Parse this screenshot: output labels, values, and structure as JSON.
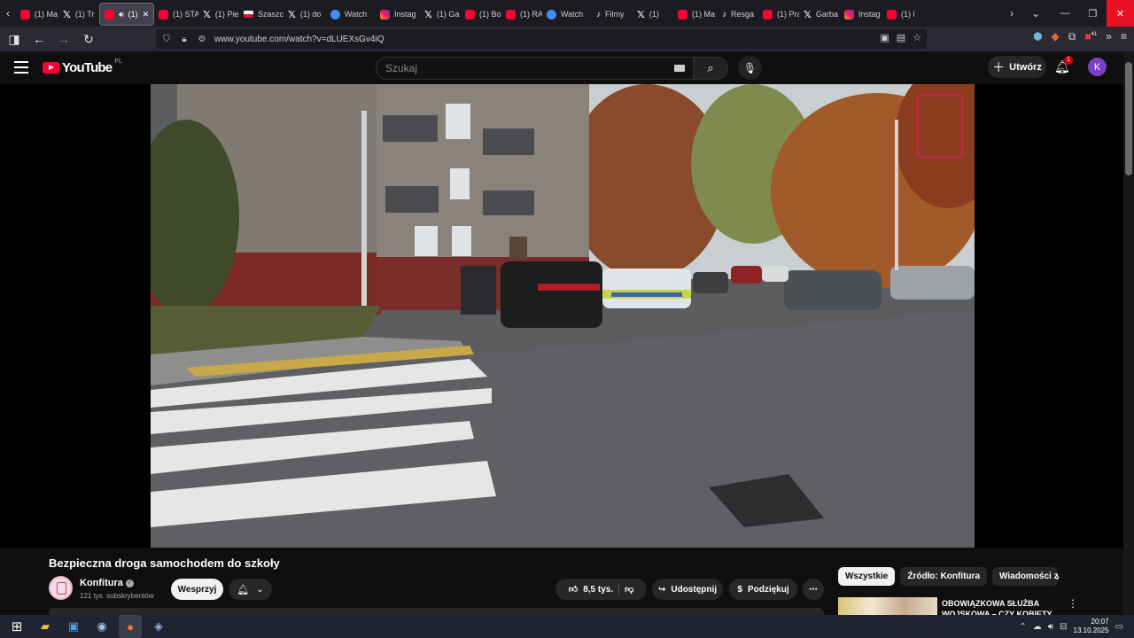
{
  "browser": {
    "tabs": [
      {
        "icon": "youtube-icon",
        "label": "(1) Ma"
      },
      {
        "icon": "x-icon",
        "label": "(1) Tr"
      },
      {
        "icon": "youtube-icon",
        "label": "(1)",
        "active": true,
        "audio": true
      },
      {
        "icon": "youtube-icon",
        "label": "(1) STA"
      },
      {
        "icon": "x-icon",
        "label": "(1) Pie"
      },
      {
        "icon": "flag-icon",
        "label": "Szaszc"
      },
      {
        "icon": "x-icon",
        "label": "(1) do"
      },
      {
        "icon": "watch-icon",
        "label": "Watch"
      },
      {
        "icon": "instagram-icon",
        "label": "Instag"
      },
      {
        "icon": "x-icon",
        "label": "(1) Ga"
      },
      {
        "icon": "youtube-icon",
        "label": "(1) Bo"
      },
      {
        "icon": "youtube-icon",
        "label": "(1) RA"
      },
      {
        "icon": "watch-icon",
        "label": "Watch"
      },
      {
        "icon": "tiktok-icon",
        "label": "Filmy"
      },
      {
        "icon": "x-icon",
        "label": "(1)"
      },
      {
        "icon": "youtube-icon",
        "label": "(1) Ma"
      },
      {
        "icon": "tiktok-icon",
        "label": "Resga"
      },
      {
        "icon": "youtube-icon",
        "label": "(1) Pra"
      },
      {
        "icon": "x-icon",
        "label": "Garba"
      },
      {
        "icon": "instagram-icon",
        "label": "Instag"
      },
      {
        "icon": "youtube-icon",
        "label": "(1) L"
      }
    ],
    "url": "www.youtube.com/watch?v=dLUEXsGv4iQ",
    "extension_badge": "41"
  },
  "youtube": {
    "logo_text": "YouTube",
    "logo_country": "PL",
    "search_placeholder": "Szukaj",
    "create_label": "Utwórz",
    "notification_count": "1",
    "avatar_letter": "K"
  },
  "video": {
    "title": "Bezpieczna droga samochodem do szkoły",
    "channel_name": "Konfitura",
    "subscribers": "121 tys. subskrybentów",
    "support_label": "Wesprzyj",
    "likes": "8,5 tys.",
    "share_label": "Udostępnij",
    "thanks_label": "Podziękuj"
  },
  "recommendations": {
    "chips": [
      "Wszystkie",
      "Źródło: Konfitura",
      "Wiadomości ze"
    ],
    "first_title": "OBOWIĄZKOWA SŁUŻBA WOJSKOWA – CZY KOBIETY"
  },
  "taskbar": {
    "time": "20:07",
    "date": "13.10.2025"
  },
  "colors": {
    "yt_red": "#ff0033",
    "bg": "#0f0f0f",
    "close_red": "#e81123",
    "avatar_purple": "#7b3fc4"
  }
}
